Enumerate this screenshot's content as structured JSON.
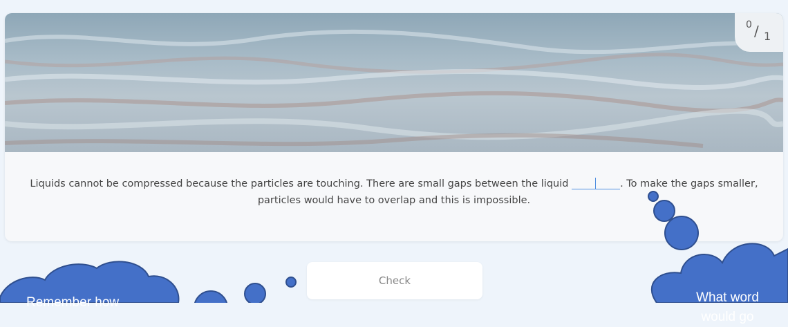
{
  "score": {
    "current": "0",
    "total": "1"
  },
  "question": {
    "text_before": "Liquids cannot be compressed because the particles are touching. There are small gaps between the liquid",
    "text_after": ". To make the gaps smaller, particles would have to overlap and this is impossible."
  },
  "check_label": "Check",
  "callouts": {
    "left": "Remember how",
    "right_line1": "What word",
    "right_line2": "would go"
  },
  "colors": {
    "bubble": "#4470c8",
    "bubble_stroke": "#2f4f8f",
    "blank_underline": "#4f8ee0"
  }
}
